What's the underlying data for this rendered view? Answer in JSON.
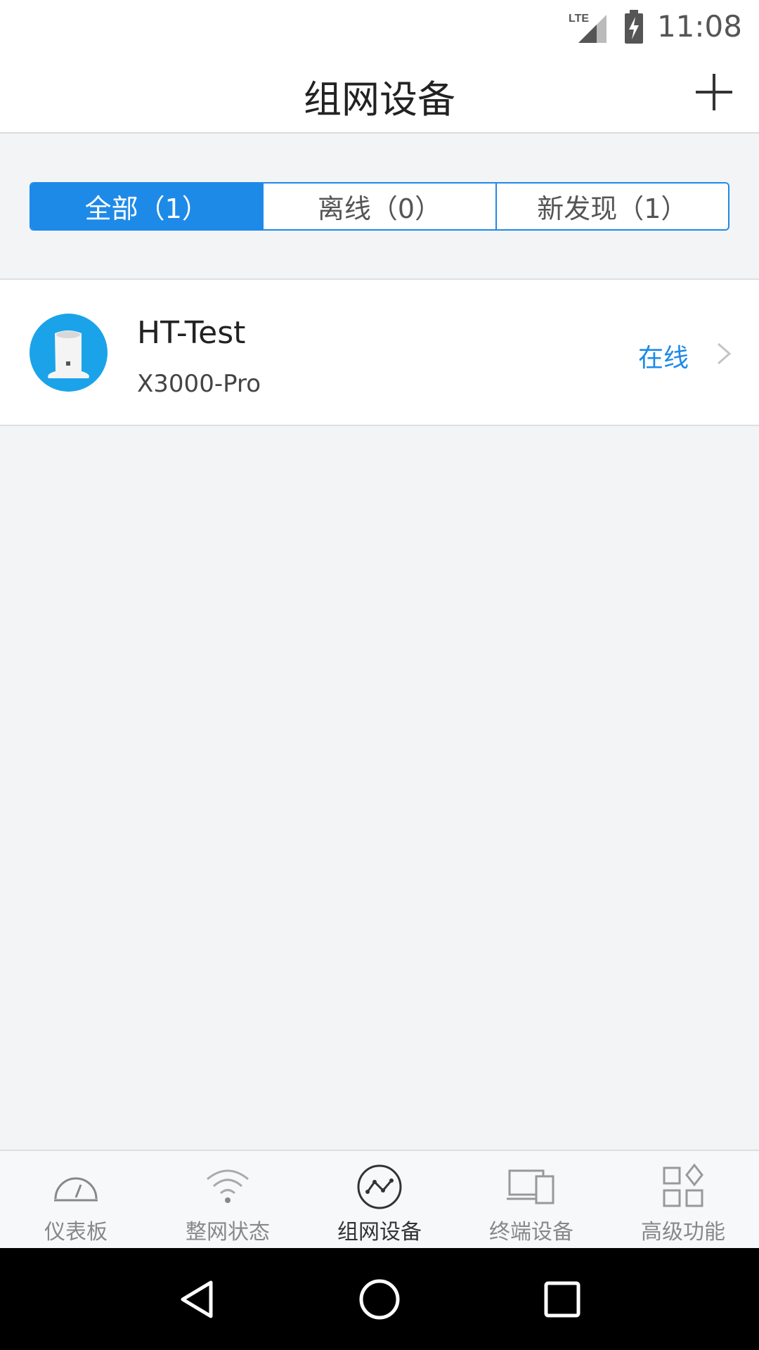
{
  "status_bar": {
    "network_label": "LTE",
    "time": "11:08"
  },
  "header": {
    "title": "组网设备",
    "add_icon": "plus-icon"
  },
  "filter_tabs": [
    {
      "label": "全部（1）",
      "active": true
    },
    {
      "label": "离线（0）",
      "active": false
    },
    {
      "label": "新发现（1）",
      "active": false
    }
  ],
  "devices": [
    {
      "name": "HT-Test",
      "model": "X3000-Pro",
      "status": "在线",
      "avatar_icon": "router-device-icon"
    }
  ],
  "bottom_tabs": [
    {
      "label": "仪表板",
      "icon": "dashboard-gauge-icon",
      "active": false
    },
    {
      "label": "整网状态",
      "icon": "wifi-icon",
      "active": false
    },
    {
      "label": "组网设备",
      "icon": "network-graph-icon",
      "active": true
    },
    {
      "label": "终端设备",
      "icon": "devices-icon",
      "active": false
    },
    {
      "label": "高级功能",
      "icon": "apps-grid-icon",
      "active": false
    }
  ],
  "colors": {
    "accent": "#1e8ae8",
    "background": "#f3f4f6",
    "avatar": "#1ba3ea"
  }
}
